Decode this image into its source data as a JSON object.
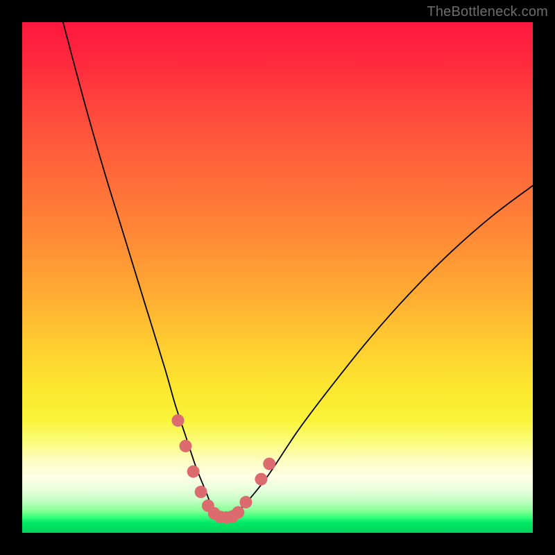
{
  "watermark": "TheBottleneck.com",
  "chart_data": {
    "type": "line",
    "title": "",
    "xlabel": "",
    "ylabel": "",
    "xlim": [
      0,
      100
    ],
    "ylim": [
      0,
      100
    ],
    "note": "Values estimated from pixel positions. x is horizontal percent, y is the curve height as percent of plot (0 = bottom, 100 = top).",
    "series": [
      {
        "name": "bottleneck-curve",
        "x": [
          8,
          12,
          16,
          20,
          24,
          28,
          30,
          32,
          34,
          36,
          37,
          38,
          39,
          40,
          41,
          42,
          44,
          48,
          54,
          60,
          68,
          76,
          84,
          92,
          100
        ],
        "y": [
          100,
          85,
          71,
          58,
          45,
          32,
          25,
          19,
          13,
          8,
          5.5,
          4,
          3.2,
          3,
          3.2,
          4,
          6,
          11,
          20,
          28,
          38,
          47,
          55,
          62,
          68
        ]
      }
    ],
    "markers": {
      "name": "highlight-dots",
      "color": "#db6b6e",
      "points": [
        {
          "x": 30.5,
          "y": 22
        },
        {
          "x": 32.0,
          "y": 17
        },
        {
          "x": 33.5,
          "y": 12
        },
        {
          "x": 35.0,
          "y": 8
        },
        {
          "x": 36.4,
          "y": 5.3
        },
        {
          "x": 37.6,
          "y": 3.8
        },
        {
          "x": 38.8,
          "y": 3.1
        },
        {
          "x": 40.0,
          "y": 3.0
        },
        {
          "x": 41.2,
          "y": 3.2
        },
        {
          "x": 42.3,
          "y": 4.0
        },
        {
          "x": 43.8,
          "y": 6.0
        },
        {
          "x": 46.8,
          "y": 10.5
        },
        {
          "x": 48.4,
          "y": 13.5
        }
      ]
    },
    "gradient_stops": [
      {
        "pos": 0,
        "color": "#ff173f"
      },
      {
        "pos": 0.3,
        "color": "#ff6a3a"
      },
      {
        "pos": 0.64,
        "color": "#ffd030"
      },
      {
        "pos": 0.82,
        "color": "#fbfb7a"
      },
      {
        "pos": 0.9,
        "color": "#feffe6"
      },
      {
        "pos": 0.97,
        "color": "#33ff78"
      },
      {
        "pos": 1.0,
        "color": "#00d45e"
      }
    ]
  }
}
